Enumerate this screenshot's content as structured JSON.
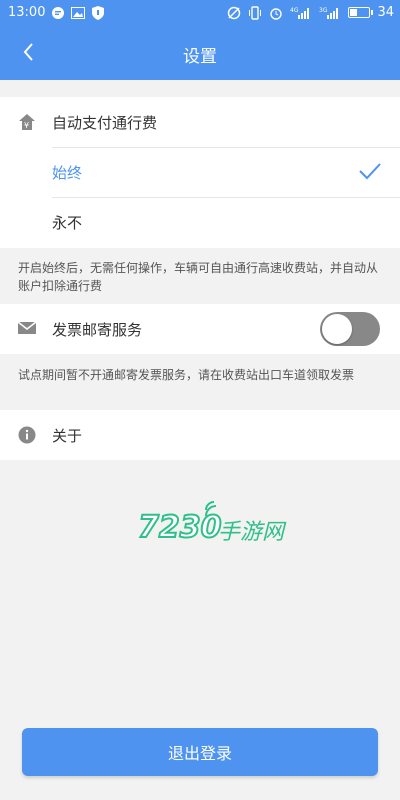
{
  "status_bar": {
    "time": "13:00",
    "battery_level": "34",
    "signal_label_1": "4G",
    "signal_label_2": "3G"
  },
  "header": {
    "title": "设置"
  },
  "autopay": {
    "label": "自动支付通行费",
    "options": [
      {
        "label": "始终",
        "selected": true
      },
      {
        "label": "永不",
        "selected": false
      }
    ],
    "note": "开启始终后，无需任何操作，车辆可自由通行高速收费站，并自动从账户扣除通行费"
  },
  "invoice": {
    "label": "发票邮寄服务",
    "enabled": false,
    "note": "试点期间暂不开通邮寄发票服务，请在收费站出口车道领取发票"
  },
  "about": {
    "label": "关于"
  },
  "watermark": {
    "number": "7230",
    "text": "手游网"
  },
  "logout_button": {
    "label": "退出登录"
  },
  "colors": {
    "primary": "#4d93ef",
    "watermark": "#2fbf8a"
  }
}
